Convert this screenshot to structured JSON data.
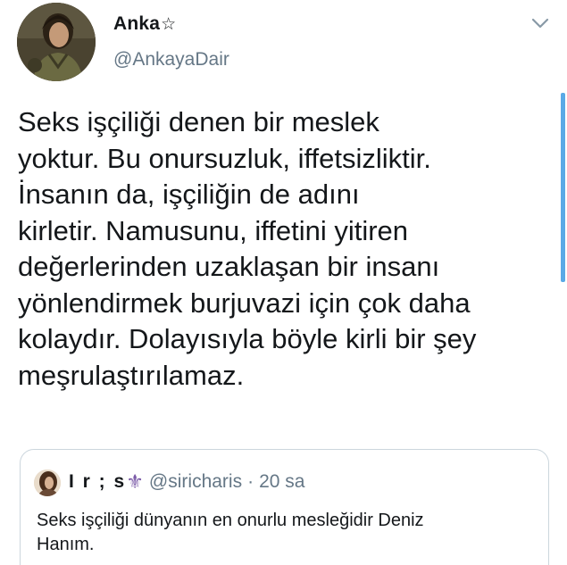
{
  "author": {
    "display_name": "Anka",
    "name_badge": "☆",
    "handle": "@AnkayaDair"
  },
  "tweet": {
    "lines": [
      "Seks işçiliği denen bir meslek",
      "yoktur. Bu onursuzluk, iffetsizliktir.",
      "İnsanın da, işçiliğin de adını",
      "kirletir. Namusunu, iffetini yitiren",
      "değerlerinden uzaklaşan bir insanı",
      "yönlendirmek burjuvazi için çok daha",
      "kolaydır. Dolayısıyla böyle kirli bir şey",
      "meşrulaştırılamaz."
    ]
  },
  "quoted": {
    "display_name": "I r ; s",
    "name_emoji": "⚜",
    "handle": "@siricharis",
    "separator": "·",
    "time": "20 sa",
    "lines": [
      "Seks işçiliği dünyanın en onurlu mesleğidir Deniz",
      "Hanım."
    ]
  },
  "icons": {
    "menu": "chevron-down-icon"
  },
  "colors": {
    "text": "#14171a",
    "secondary": "#657786",
    "border": "#ccd6dd",
    "scrollbar": "#5aa9e6"
  }
}
